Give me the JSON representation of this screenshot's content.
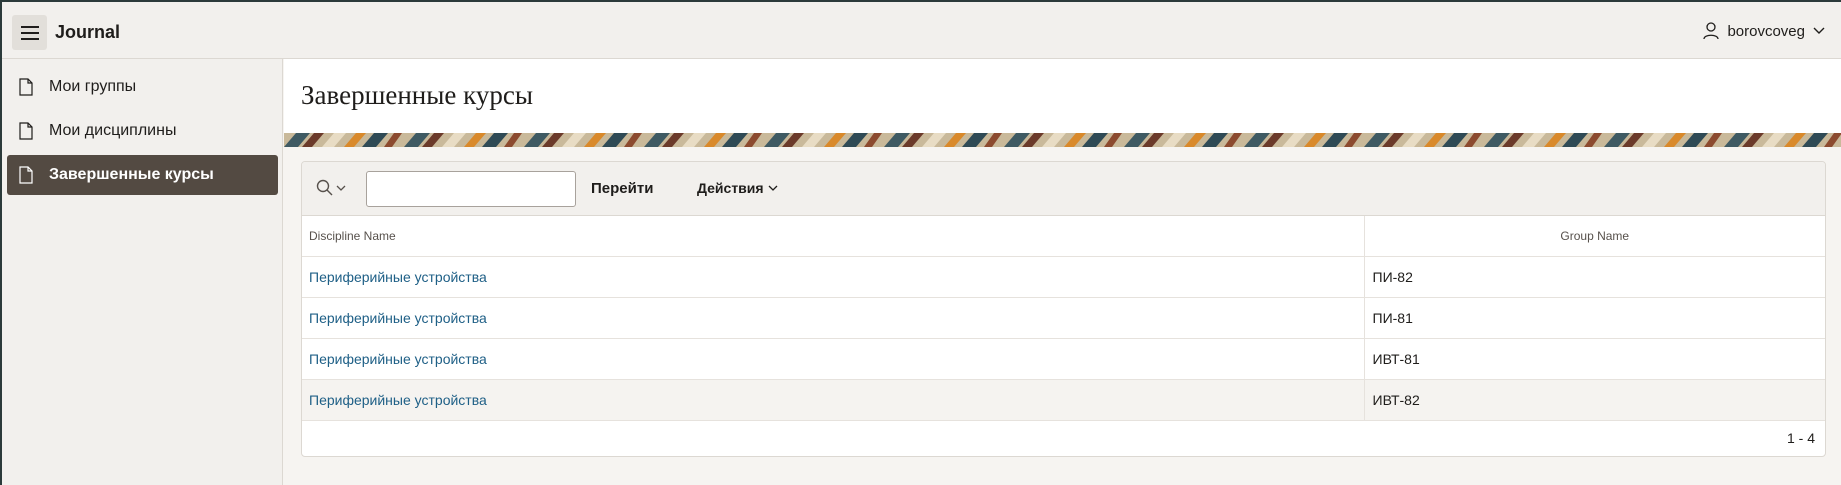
{
  "header": {
    "app_title": "Journal",
    "username": "borovcoveg",
    "icons": [
      "hamburger-menu-icon",
      "user-icon",
      "chevron-down-icon"
    ]
  },
  "sidebar": {
    "items": [
      {
        "label": "Мои группы",
        "icon": "document-icon",
        "active": false
      },
      {
        "label": "Мои дисциплины",
        "icon": "document-icon",
        "active": false
      },
      {
        "label": "Завершенные курсы",
        "icon": "document-icon",
        "active": true
      }
    ]
  },
  "page": {
    "title": "Завершенные курсы"
  },
  "report": {
    "search": {
      "value": "",
      "placeholder": "",
      "icon": "search-icon"
    },
    "go_label": "Перейти",
    "actions_label": "Действия",
    "columns": [
      "Discipline Name",
      "Group Name"
    ],
    "rows": [
      {
        "discipline": "Периферийные устройства",
        "group": "ПИ-82"
      },
      {
        "discipline": "Периферийные устройства",
        "group": "ПИ-81"
      },
      {
        "discipline": "Периферийные устройства",
        "group": "ИВТ-81"
      },
      {
        "discipline": "Периферийные устройства",
        "group": "ИВТ-82"
      }
    ],
    "pagination": "1 - 4"
  },
  "colors": {
    "active_nav_bg": "#534a42",
    "link": "#1e5f86",
    "header_bg": "#f2f0ed"
  }
}
